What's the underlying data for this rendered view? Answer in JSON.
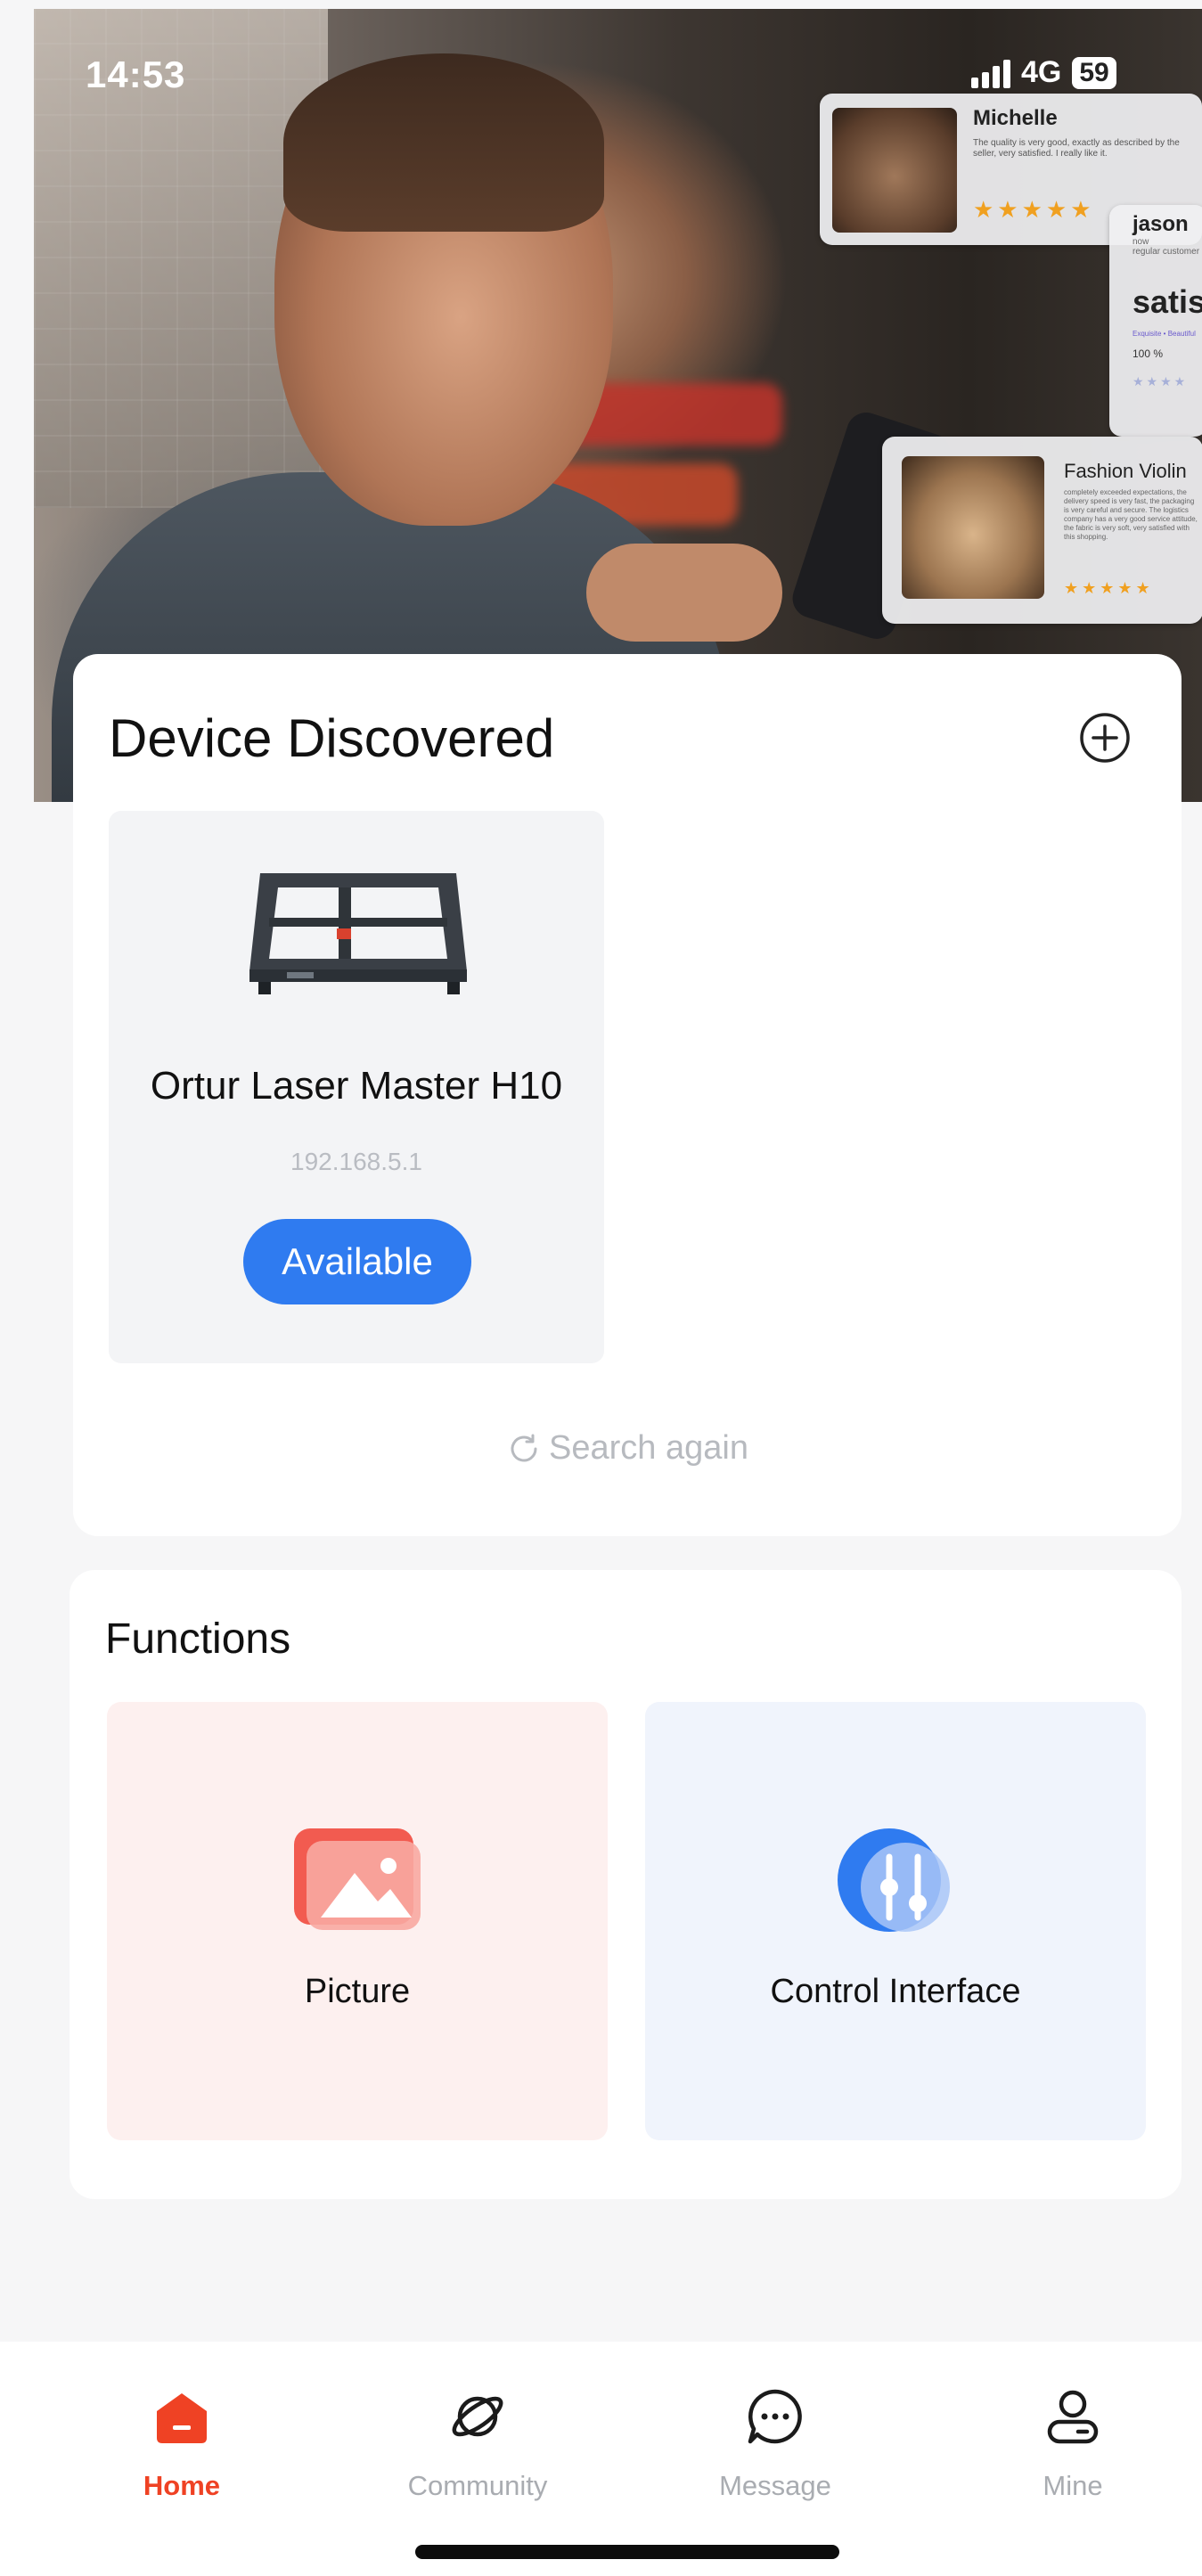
{
  "status_bar": {
    "time": "14:53",
    "network": "4G",
    "battery": "59"
  },
  "hero": {
    "reviews": [
      {
        "name": "Michelle",
        "text": "The quality is very good, exactly as described by the seller, very satisfied. I really like it.",
        "rating_stars": 5
      },
      {
        "name": "jason",
        "meta_line1": "now",
        "meta_line2": "regular customer",
        "headline": "satis",
        "tag": "Exquisite • Beautiful",
        "percent": "100 %"
      },
      {
        "name": "Fashion Violin",
        "text": "completely exceeded expectations, the delivery speed is very fast, the packaging is very careful and secure. The logistics company has a very good service attitude, the fabric is very soft, very satisfied with this shopping.",
        "rating_stars": 5
      }
    ]
  },
  "devices": {
    "title": "Device Discovered",
    "items": [
      {
        "name": "Ortur Laser Master H10",
        "ip": "192.168.5.1",
        "status": "Available"
      }
    ],
    "search_again": "Search again"
  },
  "functions": {
    "title": "Functions",
    "items": [
      {
        "label": "Picture",
        "icon": "image-icon",
        "color": "#f25b50"
      },
      {
        "label": "Control Interface",
        "icon": "sliders-icon",
        "color": "#2f7bf0"
      }
    ]
  },
  "tabbar": {
    "items": [
      {
        "label": "Home",
        "icon": "home-icon",
        "active": true
      },
      {
        "label": "Community",
        "icon": "planet-icon",
        "active": false
      },
      {
        "label": "Message",
        "icon": "chat-icon",
        "active": false
      },
      {
        "label": "Mine",
        "icon": "person-icon",
        "active": false
      }
    ]
  },
  "colors": {
    "accent_blue": "#2f7bf0",
    "accent_red": "#ef4224",
    "inactive_gray": "#a9acb1"
  }
}
